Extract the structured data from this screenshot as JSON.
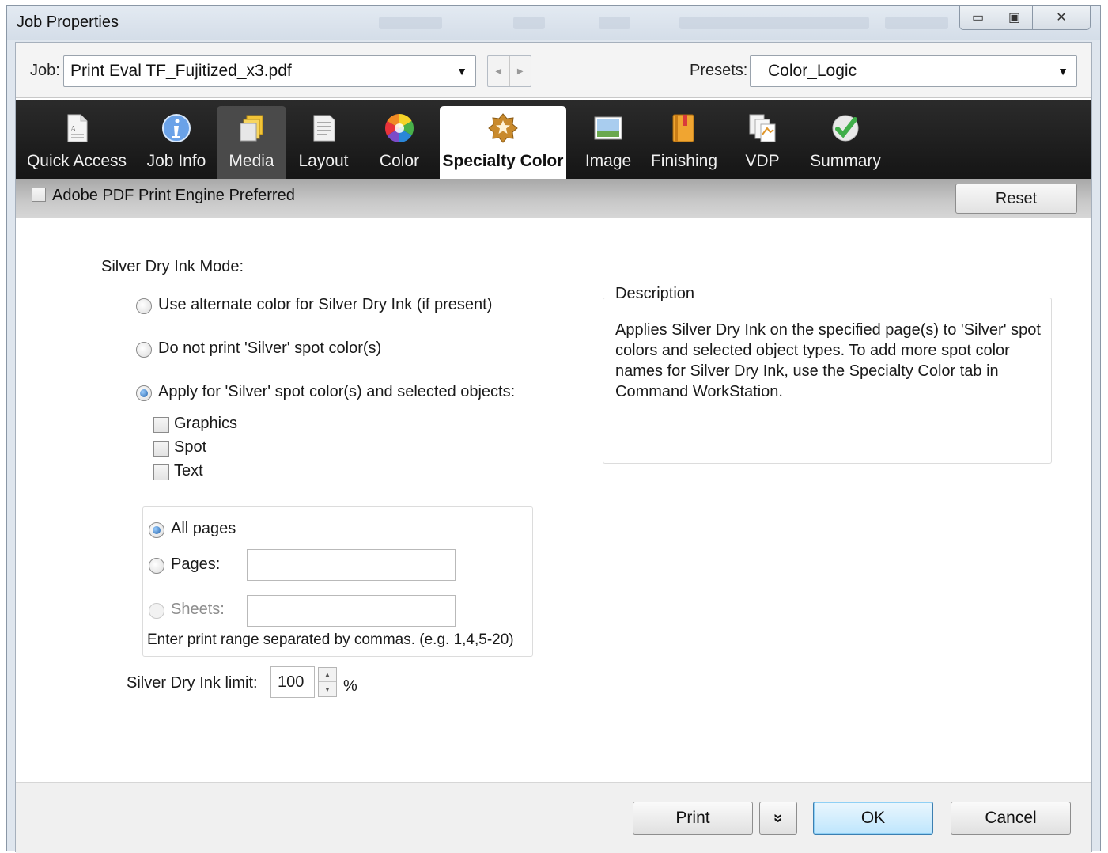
{
  "window": {
    "title": "Job Properties",
    "controls": [
      "minimize-icon",
      "maximize-icon",
      "close-icon"
    ]
  },
  "jobbar": {
    "job_label": "Job:",
    "job_value": "Print Eval TF_Fujitized_x3.pdf",
    "presets_label": "Presets:",
    "presets_value": "Color_Logic"
  },
  "tabs": [
    {
      "label": "Quick Access",
      "icon": "document-icon"
    },
    {
      "label": "Job Info",
      "icon": "info-icon"
    },
    {
      "label": "Media",
      "icon": "media-stack-icon"
    },
    {
      "label": "Layout",
      "icon": "layout-page-icon"
    },
    {
      "label": "Color",
      "icon": "color-wheel-icon"
    },
    {
      "label": "Specialty Color",
      "icon": "specialty-star-icon",
      "active": true
    },
    {
      "label": "Image",
      "icon": "image-landscape-icon"
    },
    {
      "label": "Finishing",
      "icon": "finishing-book-icon"
    },
    {
      "label": "VDP",
      "icon": "vdp-pages-icon"
    },
    {
      "label": "Summary",
      "icon": "checkmark-icon"
    }
  ],
  "enginebar": {
    "adobe_label": "Adobe PDF Print Engine Preferred",
    "reset_label": "Reset"
  },
  "silver": {
    "mode_label": "Silver Dry Ink Mode:",
    "option_alternate": "Use alternate color for Silver Dry Ink (if present)",
    "option_noprint": "Do not print 'Silver' spot color(s)",
    "option_apply": "Apply for 'Silver' spot color(s) and selected objects:",
    "selected_option": "apply",
    "objects": {
      "graphics": "Graphics",
      "spot": "Spot",
      "text": "Text"
    },
    "range": {
      "all_pages": "All pages",
      "pages": "Pages:",
      "sheets": "Sheets:",
      "hint": "Enter print range separated by commas. (e.g. 1,4,5-20)",
      "selected": "all_pages"
    },
    "limit_label": "Silver Dry Ink limit:",
    "limit_value": "100",
    "limit_unit": "%"
  },
  "description": {
    "title": "Description",
    "text": "Applies Silver Dry Ink on the specified page(s) to 'Silver' spot colors and selected object types. To add more spot color names for Silver Dry Ink, use the Specialty Color tab in Command WorkStation."
  },
  "footer": {
    "print": "Print",
    "more": "»",
    "ok": "OK",
    "cancel": "Cancel"
  },
  "colors": {
    "toolbar_bg": "#1e1e1e",
    "ok_accent": "#bee6fd",
    "radio_selected": "#1f5fa8"
  }
}
